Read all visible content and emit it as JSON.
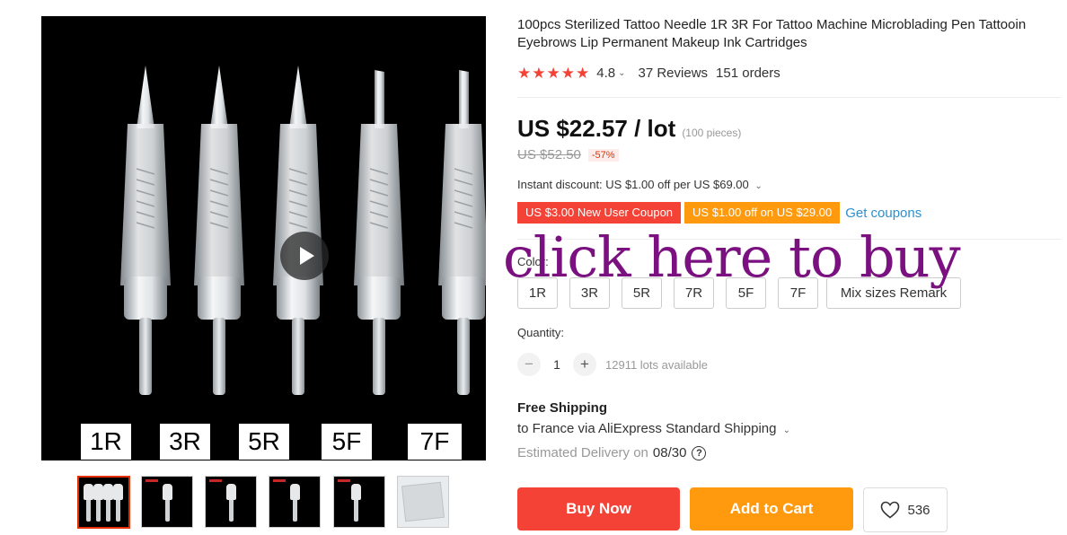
{
  "gallery": {
    "size_labels": [
      "1R",
      "3R",
      "5R",
      "5F",
      "7F"
    ],
    "thumbnails": [
      {
        "name": "thumb-1",
        "active": true
      },
      {
        "name": "thumb-2",
        "active": false
      },
      {
        "name": "thumb-3",
        "active": false
      },
      {
        "name": "thumb-4",
        "active": false
      },
      {
        "name": "thumb-5",
        "active": false
      },
      {
        "name": "thumb-6",
        "active": false
      }
    ]
  },
  "product": {
    "title": "100pcs Sterilized Tattoo Needle 1R 3R For Tattoo Machine Microblading Pen Tattooin Eyebrows Lip Permanent Makeup Ink Cartridges",
    "rating": "4.8",
    "star_count": 5,
    "reviews": "37 Reviews",
    "orders": "151 orders"
  },
  "pricing": {
    "price": "US $22.57 / lot",
    "unit_note": "(100 pieces)",
    "original_price": "US $52.50",
    "discount": "-57%",
    "instant_discount": "Instant discount: US $1.00 off per US $69.00",
    "coupons": [
      "US $3.00 New User Coupon",
      "US $1.00 off on US $29.00"
    ],
    "get_coupons": "Get coupons"
  },
  "overlay": {
    "text": "click here to buy"
  },
  "color": {
    "label": "Color:",
    "options": [
      "1R",
      "3R",
      "5R",
      "7R",
      "5F",
      "7F",
      "Mix sizes Remark"
    ]
  },
  "quantity": {
    "label": "Quantity:",
    "minus": "−",
    "value": "1",
    "plus": "+",
    "available": "12911 lots available"
  },
  "shipping": {
    "title": "Free Shipping",
    "to": "to France via AliExpress Standard Shipping",
    "estimated_label": "Estimated Delivery on",
    "estimated_date": "08/30",
    "help": "?"
  },
  "actions": {
    "buy_now": "Buy Now",
    "add_to_cart": "Add to Cart",
    "wishlist_count": "536"
  },
  "colors": {
    "accent_red": "#f44336",
    "accent_orange": "#ff9a0e",
    "link_blue": "#2e8fcf",
    "overlay_purple": "#7b1180"
  }
}
